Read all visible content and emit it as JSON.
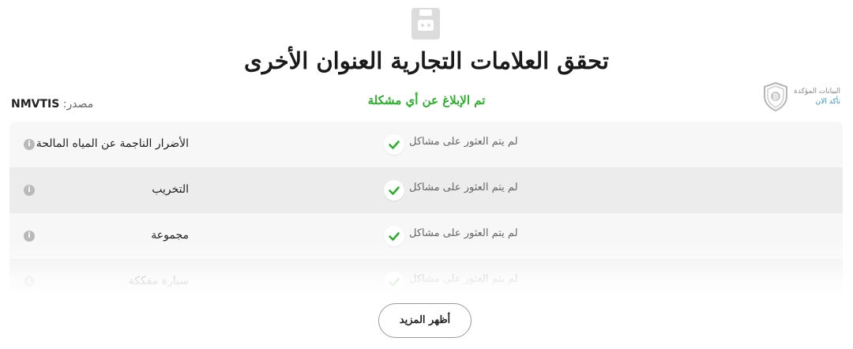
{
  "header": {
    "title": "تحقق العلامات التجارية العنوان الأخرى",
    "status": "تم الإبلاغ عن أي مشكلة"
  },
  "source": {
    "label": ":مصدر",
    "value": "NMVTIS"
  },
  "verified_badge": {
    "line1": "البيانات المؤكدة",
    "line2": "تأكد الان"
  },
  "checks": [
    {
      "label": "الأضرار الناجمة عن المياه المالحة",
      "result": "لم يتم العثور على مشاكل"
    },
    {
      "label": "التخريب",
      "result": "لم يتم العثور على مشاكل"
    },
    {
      "label": "مجموعة",
      "result": "لم يتم العثور على مشاكل"
    },
    {
      "label": "سيارة مفككة",
      "result": "لم يتم العثور على مشاكل"
    }
  ],
  "show_more_label": "أظهر المزيد",
  "colors": {
    "status_green": "#2bb02b",
    "check_green": "#2bb02b",
    "link_blue": "#2a8fd8"
  },
  "icons": {
    "top": "report-icon",
    "badge": "shield-bitcoin-icon",
    "info": "info-icon",
    "check": "check-icon"
  }
}
